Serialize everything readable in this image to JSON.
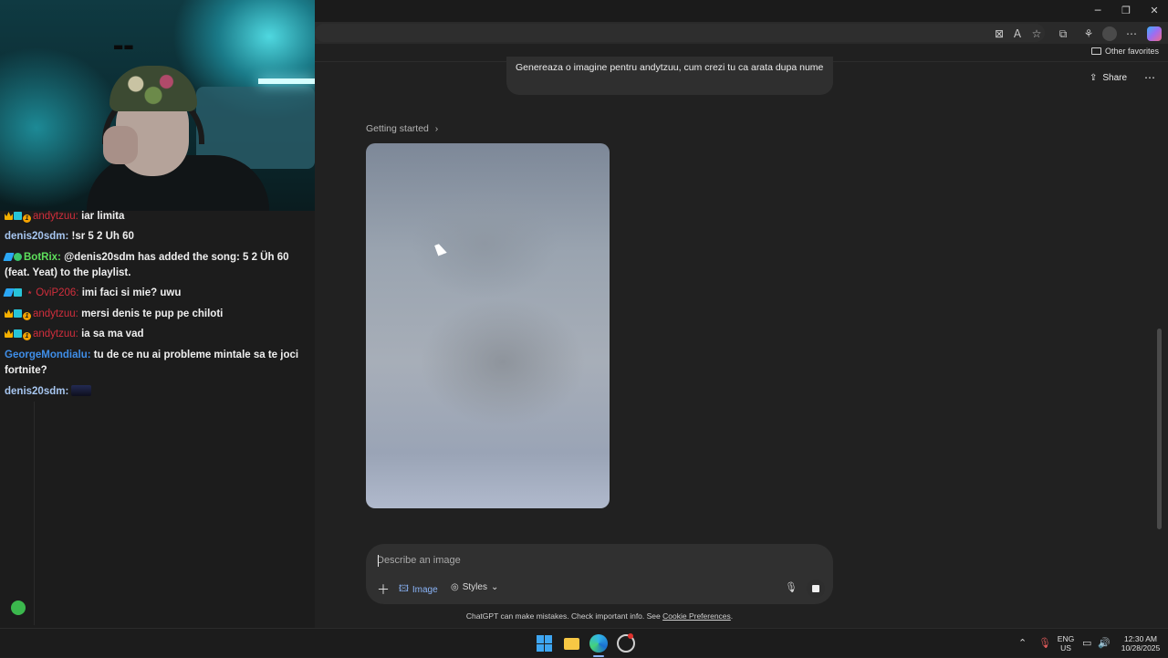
{
  "browser": {
    "window_controls": {
      "minimize": "─",
      "restore": "❐",
      "close": "✕"
    },
    "favorites_bar": {
      "other_favorites": "Other favorites"
    }
  },
  "chat_page": {
    "share_label": "Share",
    "user_message": "Genereaza o imagine pentru andytzuu, cum crezi tu ca arata dupa nume",
    "getting_started": "Getting started",
    "getting_started_chevron": "›",
    "composer": {
      "placeholder": "Describe an image",
      "image_chip": "Image",
      "styles_chip": "Styles"
    },
    "disclaimer_prefix": "ChatGPT can make mistakes. Check important info. See ",
    "disclaimer_link": "Cookie Preferences",
    "disclaimer_suffix": "."
  },
  "stream_chat": {
    "messages": [
      {
        "user": "andytzuu:",
        "text": "iar limita"
      },
      {
        "user": "denis20sdm:",
        "text": "!sr 5 2 Uh 60"
      },
      {
        "user": "BotRix:",
        "text": "@denis20sdm has added the song: 5 2 Üh 60 (feat. Yeat) to the playlist."
      },
      {
        "user": "OviP206:",
        "text": "imi faci si mie? uwu",
        "user_prefix": "⋆"
      },
      {
        "user": "andytzuu:",
        "text": "mersi denis te pup pe chiloti"
      },
      {
        "user": "andytzuu:",
        "text": "ia sa ma vad"
      },
      {
        "user": "GeorgeMondialu:",
        "text": "tu de ce nu ai probleme mintale sa te joci fortnite?"
      },
      {
        "user": "denis20sdm:",
        "text": ""
      }
    ],
    "badge_one": "1"
  },
  "taskbar": {
    "language": "ENG",
    "region": "US",
    "time": "12:30 AM",
    "date": "10/28/2025"
  }
}
